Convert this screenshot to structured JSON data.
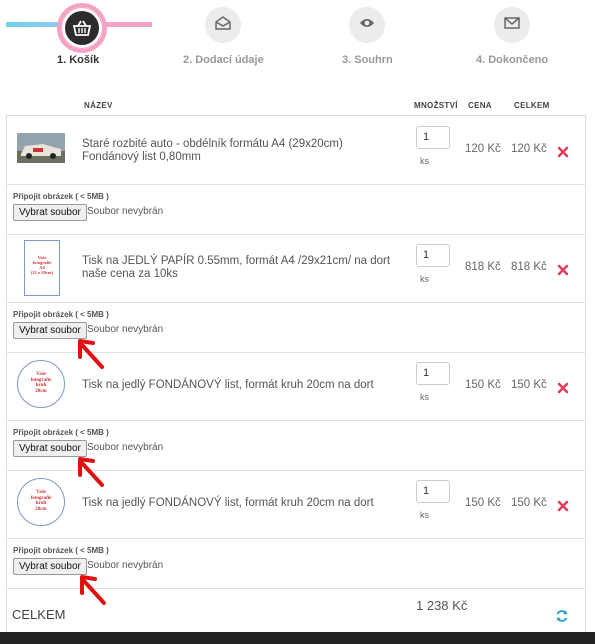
{
  "steps": [
    {
      "label": "1. Košík",
      "icon": "basket-icon",
      "active": true
    },
    {
      "label": "2. Dodací údaje",
      "icon": "envelope-open-icon",
      "active": false
    },
    {
      "label": "3. Souhrn",
      "icon": "eye-icon",
      "active": false
    },
    {
      "label": "4. Dokončeno",
      "icon": "envelope-icon",
      "active": false
    }
  ],
  "columns": {
    "name": "NÁZEV",
    "qty": "MNOŽSTVÍ",
    "price": "CENA",
    "total": "CELKEM"
  },
  "items": [
    {
      "name": "Staré rozbité auto - obdélník formátu A4 (29x20cm) Fondánový list 0,80mm",
      "qty": "1",
      "unit": "ks",
      "price": "120 Kč",
      "total": "120 Kč"
    },
    {
      "name": "Tisk na JEDLÝ PAPÍR 0.55mm, formát A4 /29x21cm/ na dort naše cena za 10ks",
      "qty": "1",
      "unit": "ks",
      "price": "818 Kč",
      "total": "818 Kč"
    },
    {
      "name": "Tisk na jedlý FONDÁNOVÝ list, formát kruh 20cm na dort",
      "qty": "1",
      "unit": "ks",
      "price": "150 Kč",
      "total": "150 Kč"
    },
    {
      "name": "Tisk na jedlý FONDÁNOVÝ list, formát kruh 20cm na dort",
      "qty": "1",
      "unit": "ks",
      "price": "150 Kč",
      "total": "150 Kč"
    }
  ],
  "thumbs": {
    "a4_text": [
      "Vaše",
      "fotografie",
      "A4",
      "(21 x 29cm)"
    ],
    "round_text": [
      "Vaše",
      "fotografie",
      "kruh",
      "20cm"
    ]
  },
  "upload": {
    "label": "Připojit obrázek ( < 5MB )",
    "button": "Vybrat soubor",
    "none": "Soubor nevybrán"
  },
  "summary": {
    "label": "CELKEM",
    "value": "1 238 Kč"
  },
  "colors": {
    "accent_pink": "#f4a3c5",
    "accent_blue": "#6fd3e8",
    "delete_red": "#e0405a",
    "refresh_teal": "#2aa6c9"
  }
}
